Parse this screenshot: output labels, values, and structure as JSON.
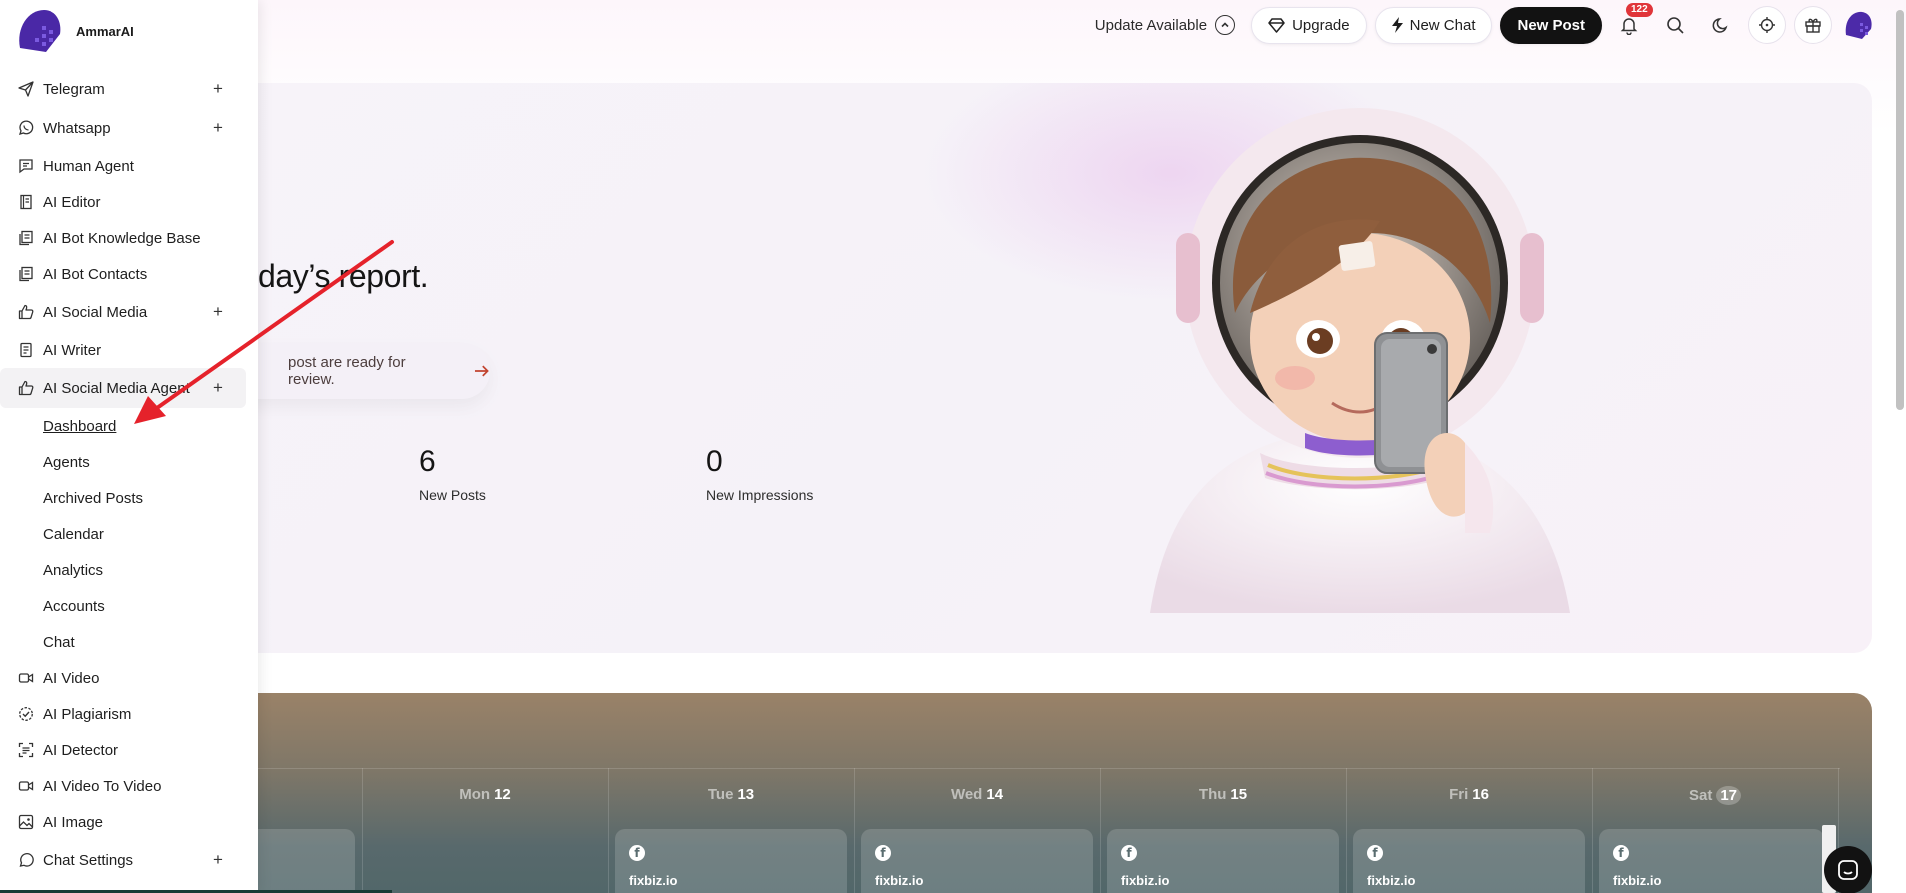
{
  "brand": {
    "name": "AmmarAI"
  },
  "header": {
    "update_label": "Update Available",
    "upgrade_label": "Upgrade",
    "new_chat_label": "New Chat",
    "new_post_label": "New Post",
    "notification_count": "122"
  },
  "sidebar": {
    "items": [
      {
        "label": "Telegram",
        "icon": "send-icon",
        "expandable": true
      },
      {
        "label": "Whatsapp",
        "icon": "whatsapp-icon",
        "expandable": true
      },
      {
        "label": "Human Agent",
        "icon": "chat-icon",
        "expandable": false
      },
      {
        "label": "AI Editor",
        "icon": "book-icon",
        "expandable": false
      },
      {
        "label": "AI Bot Knowledge Base",
        "icon": "copy-icon",
        "expandable": false
      },
      {
        "label": "AI Bot Contacts",
        "icon": "copy-icon",
        "expandable": false
      },
      {
        "label": "AI Social Media",
        "icon": "thumbs-up-icon",
        "expandable": true
      },
      {
        "label": "AI Writer",
        "icon": "document-icon",
        "expandable": false
      },
      {
        "label": "AI Social Media Agent",
        "icon": "thumbs-up-icon",
        "expandable": true
      }
    ],
    "sub_items": [
      "Dashboard",
      "Agents",
      "Archived Posts",
      "Calendar",
      "Analytics",
      "Accounts",
      "Chat"
    ],
    "items_after": [
      {
        "label": "AI Video",
        "icon": "video-icon",
        "expandable": false
      },
      {
        "label": "AI Plagiarism",
        "icon": "check-circle-icon",
        "expandable": false
      },
      {
        "label": "AI Detector",
        "icon": "scan-icon",
        "expandable": false
      },
      {
        "label": "AI Video To Video",
        "icon": "video-icon",
        "expandable": false
      },
      {
        "label": "AI Image",
        "icon": "image-icon",
        "expandable": false
      },
      {
        "label": "Chat Settings",
        "icon": "chat-bubble-icon",
        "expandable": true
      }
    ]
  },
  "hero": {
    "title": "day’s report.",
    "review_text": "post are ready for review.",
    "stats": [
      {
        "value": "6",
        "label": "New Posts"
      },
      {
        "value": "0",
        "label": "New Impressions"
      }
    ]
  },
  "calendar": {
    "days": [
      {
        "name": "Mon",
        "num": "12"
      },
      {
        "name": "Tue",
        "num": "13"
      },
      {
        "name": "Wed",
        "num": "14"
      },
      {
        "name": "Thu",
        "num": "15"
      },
      {
        "name": "Fri",
        "num": "16"
      },
      {
        "name": "Sat",
        "num": "17"
      }
    ],
    "posts": [
      "fixbiz.io",
      "fixbiz.io",
      "fixbiz.io",
      "fixbiz.io",
      "fixbiz.io"
    ]
  },
  "colors": {
    "accent": "#121212",
    "badge": "#e0353a",
    "brand_purple": "#5a2fc4"
  }
}
